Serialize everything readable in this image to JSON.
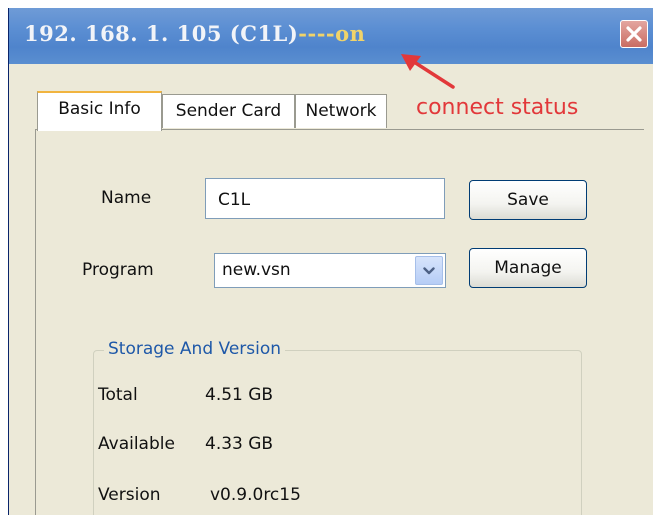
{
  "window": {
    "title_ip": "192. 168. 1. 105 (C1L)",
    "title_status": "----on",
    "close_icon": "close-icon",
    "title_bar_color": "#5c8fd3",
    "close_color": "#c96d63"
  },
  "annotation": {
    "text": "connect status",
    "color": "#e2383a"
  },
  "tabs": [
    {
      "label": "Basic Info",
      "active": true
    },
    {
      "label": "Sender Card",
      "active": false
    },
    {
      "label": "Network",
      "active": false
    }
  ],
  "form": {
    "name_label": "Name",
    "name_value": "C1L",
    "program_label": "Program",
    "program_value": "new.vsn",
    "save_label": "Save",
    "manage_label": "Manage"
  },
  "storage": {
    "title": "Storage And Version",
    "rows": [
      {
        "label": "Total",
        "value": "4.51 GB"
      },
      {
        "label": "Available",
        "value": "4.33 GB"
      },
      {
        "label": "Version",
        "value": "v0.9.0rc15"
      }
    ]
  }
}
